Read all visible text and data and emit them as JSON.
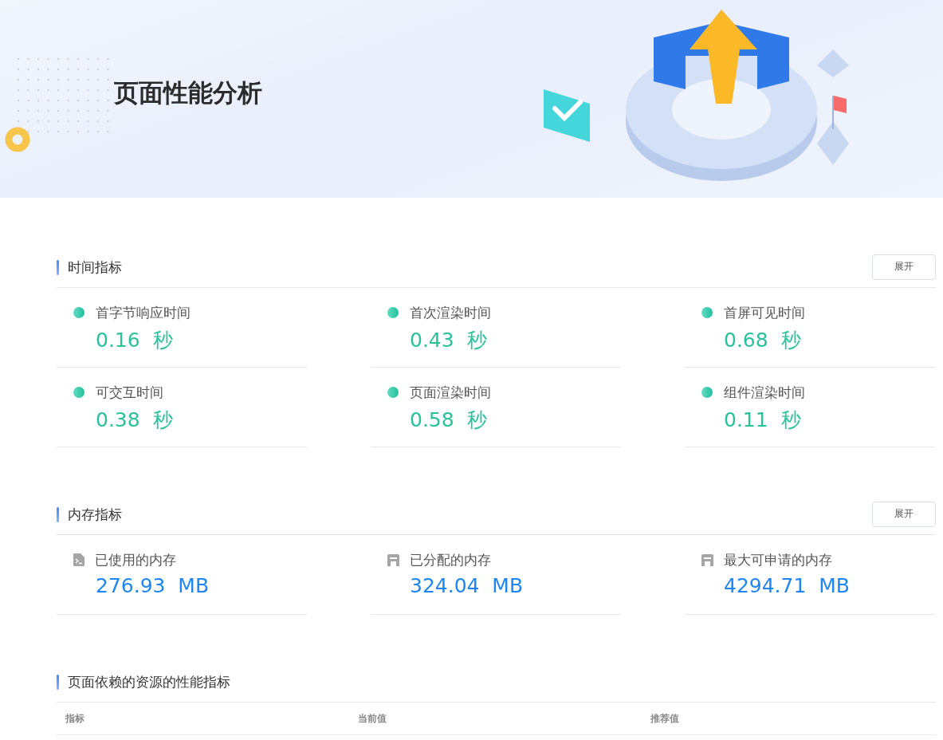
{
  "banner": {
    "title": "页面性能分析"
  },
  "sections": [
    {
      "title": "时间指标",
      "kind": "time",
      "button": "展开",
      "metrics": [
        {
          "kind": "dot",
          "label": "首字节响应时间",
          "value": "0.16",
          "unit": "秒"
        },
        {
          "kind": "dot",
          "label": "首次渲染时间",
          "value": "0.43",
          "unit": "秒"
        },
        {
          "kind": "dot",
          "label": "首屏可见时间",
          "value": "0.68",
          "unit": "秒"
        },
        {
          "kind": "dot",
          "label": "可交互时间",
          "value": "0.38",
          "unit": "秒"
        },
        {
          "kind": "dot",
          "label": "页面渲染时间",
          "value": "0.58",
          "unit": "秒"
        },
        {
          "kind": "dot",
          "label": "组件渲染时间",
          "value": "0.11",
          "unit": "秒"
        }
      ]
    },
    {
      "title": "内存指标",
      "kind": "memory",
      "button": "展开",
      "metrics": [
        {
          "kind": "used",
          "label": "已使用的内存",
          "value": "276.93",
          "unit": "MB"
        },
        {
          "kind": "allocated",
          "label": "已分配的内存",
          "value": "324.04",
          "unit": "MB"
        },
        {
          "kind": "allocated",
          "label": "最大可申请的内存",
          "value": "4294.71",
          "unit": "MB"
        }
      ]
    }
  ],
  "resources": {
    "title": "页面依赖的资源的性能指标",
    "table": {
      "columns": [
        "指标",
        "当前值",
        "推荐值"
      ]
    }
  }
}
